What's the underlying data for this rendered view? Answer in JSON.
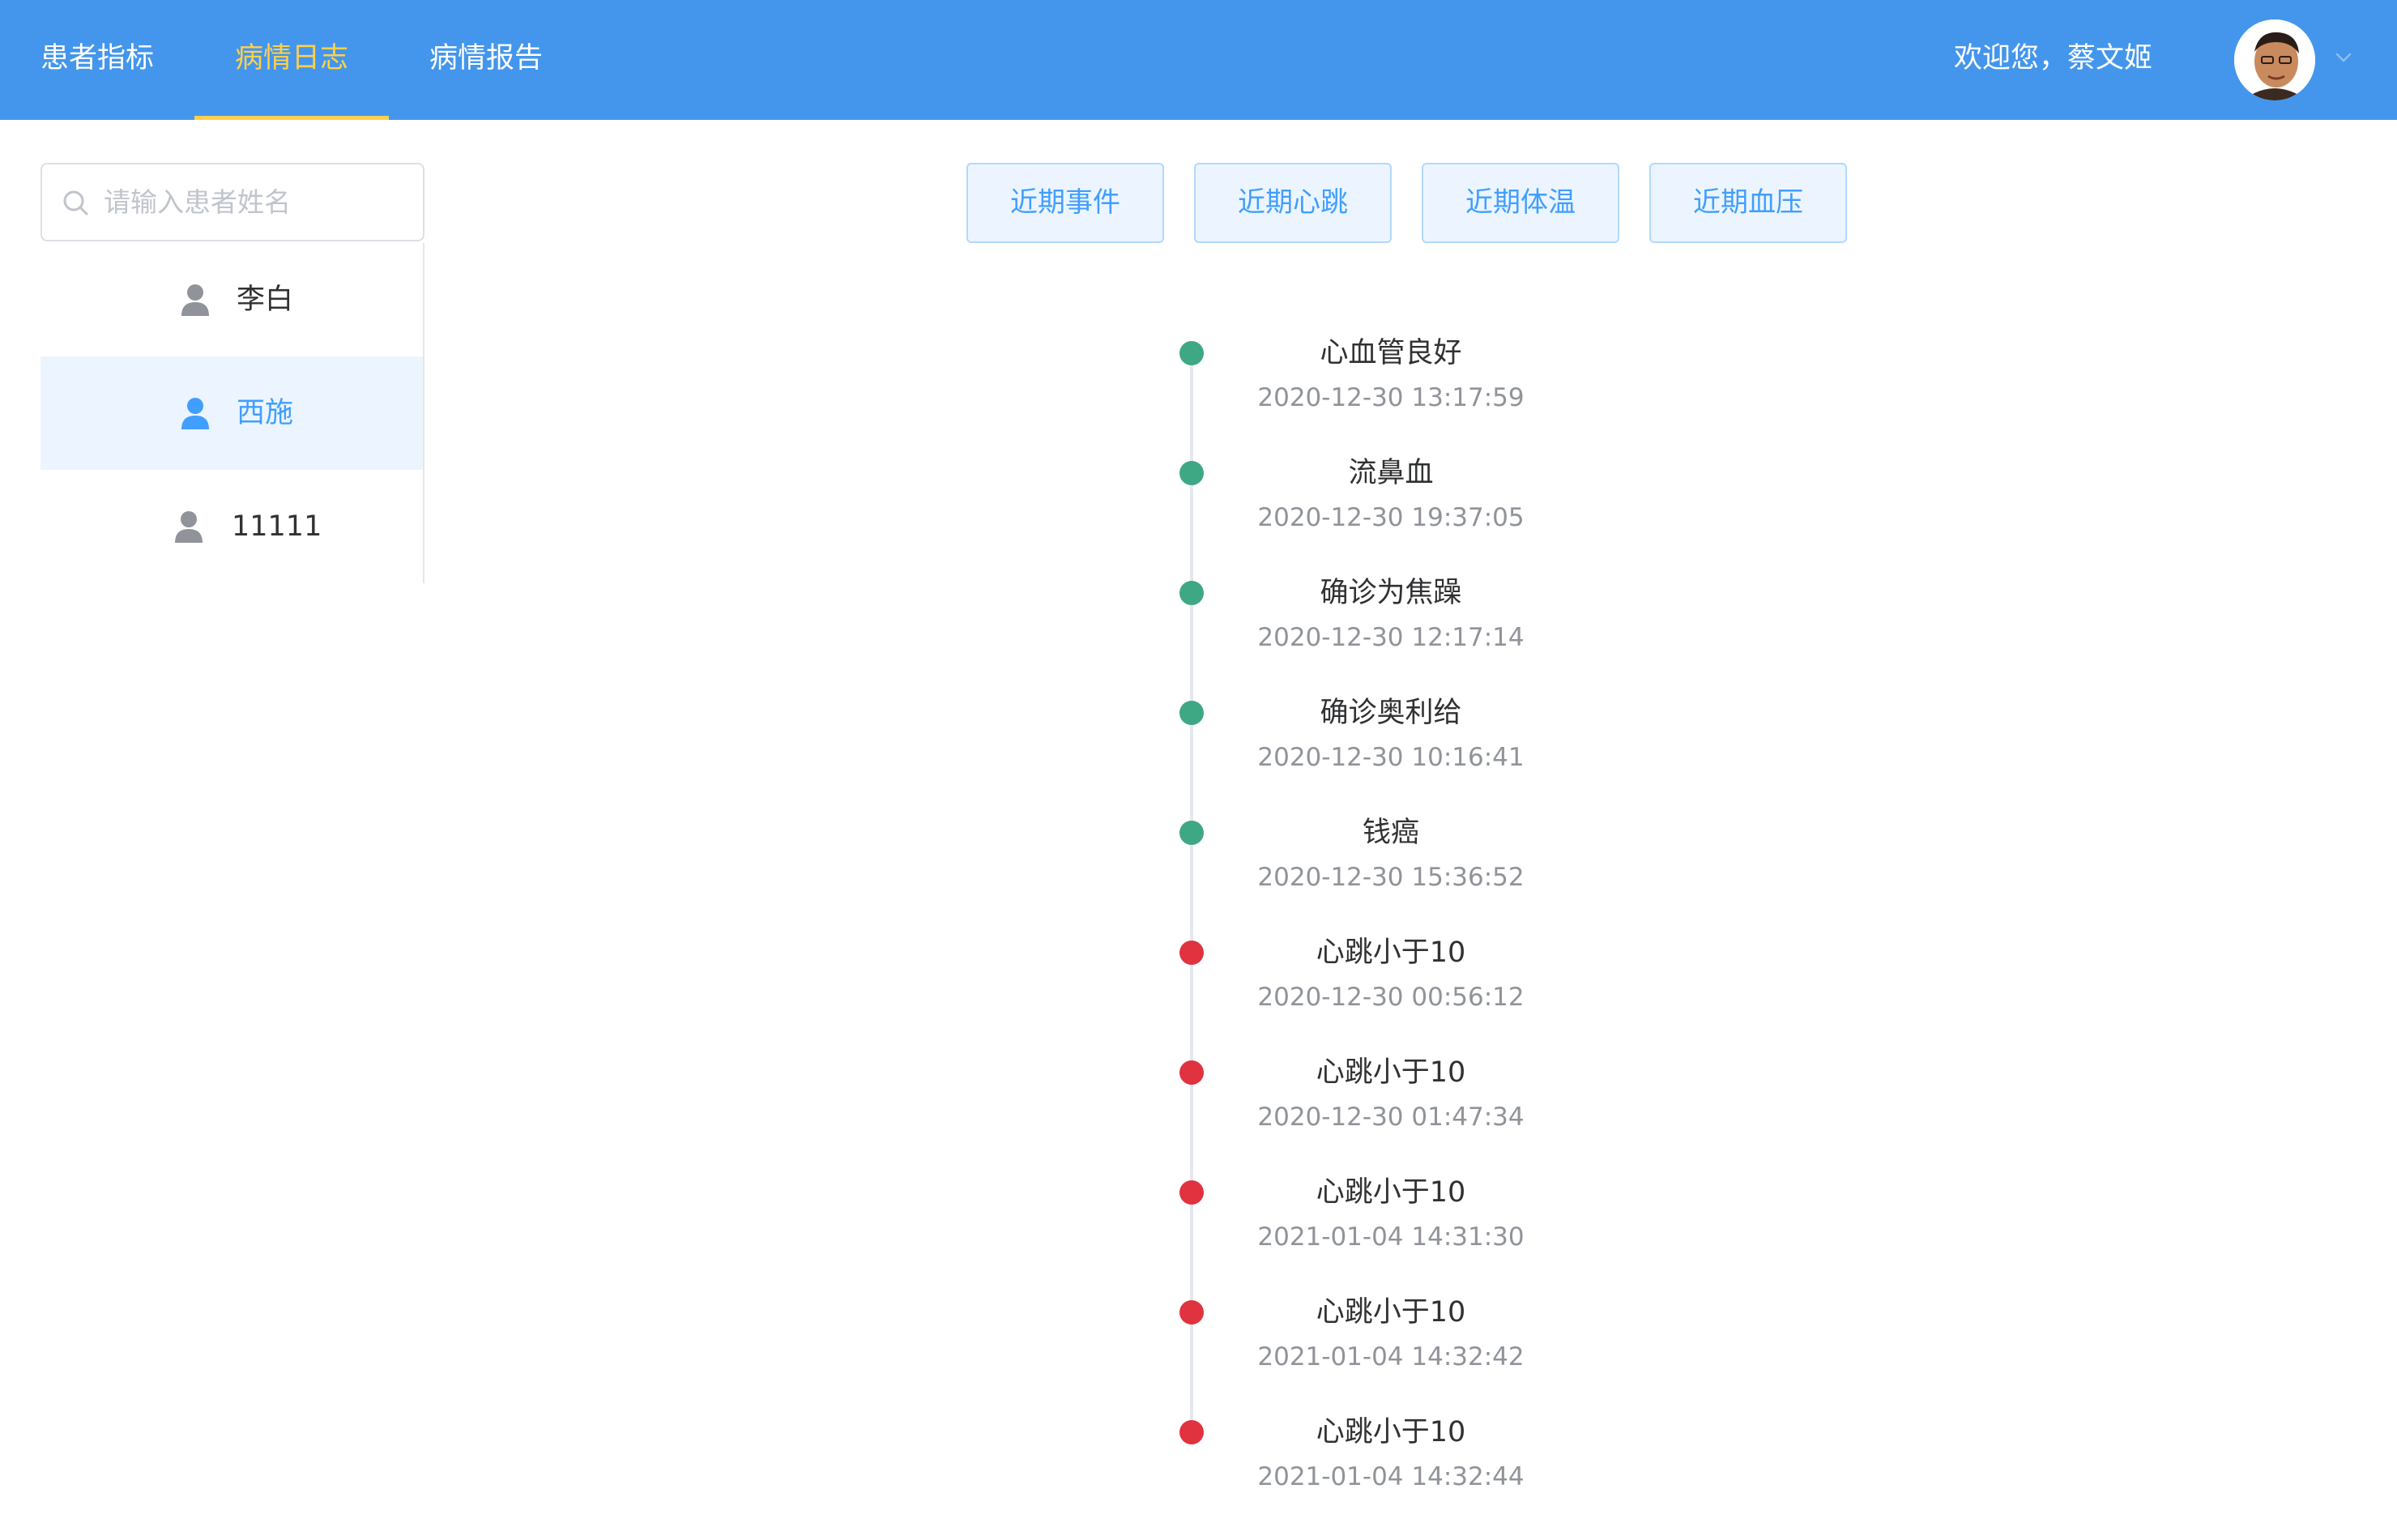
{
  "nav": {
    "items": [
      {
        "label": "患者指标"
      },
      {
        "label": "病情日志"
      },
      {
        "label": "病情报告"
      }
    ],
    "active_index": 1,
    "welcome": "欢迎您，蔡文姬"
  },
  "colors": {
    "header_bg": "#4396ec",
    "active_nav": "#ffd04b",
    "accent": "#409eff",
    "normal_event": "#3ea784",
    "alert_event": "#e0323f"
  },
  "sidebar": {
    "search_placeholder": "请输入患者姓名",
    "patients": [
      {
        "name": "李白",
        "selected": false
      },
      {
        "name": "西施",
        "selected": true
      },
      {
        "name": "11111",
        "selected": false
      }
    ]
  },
  "filters": [
    {
      "label": "近期事件"
    },
    {
      "label": "近期心跳"
    },
    {
      "label": "近期体温"
    },
    {
      "label": "近期血压"
    }
  ],
  "timeline": [
    {
      "title": "心血管良好",
      "time": "2020-12-30 13:17:59",
      "status": "normal"
    },
    {
      "title": "流鼻血",
      "time": "2020-12-30 19:37:05",
      "status": "normal"
    },
    {
      "title": "确诊为焦躁",
      "time": "2020-12-30 12:17:14",
      "status": "normal"
    },
    {
      "title": "确诊奥利给",
      "time": "2020-12-30 10:16:41",
      "status": "normal"
    },
    {
      "title": "钱癌",
      "time": "2020-12-30 15:36:52",
      "status": "normal"
    },
    {
      "title": "心跳小于10",
      "time": "2020-12-30 00:56:12",
      "status": "alert"
    },
    {
      "title": "心跳小于10",
      "time": "2020-12-30 01:47:34",
      "status": "alert"
    },
    {
      "title": "心跳小于10",
      "time": "2021-01-04 14:31:30",
      "status": "alert"
    },
    {
      "title": "心跳小于10",
      "time": "2021-01-04 14:32:42",
      "status": "alert"
    },
    {
      "title": "心跳小于10",
      "time": "2021-01-04 14:32:44",
      "status": "alert"
    }
  ]
}
